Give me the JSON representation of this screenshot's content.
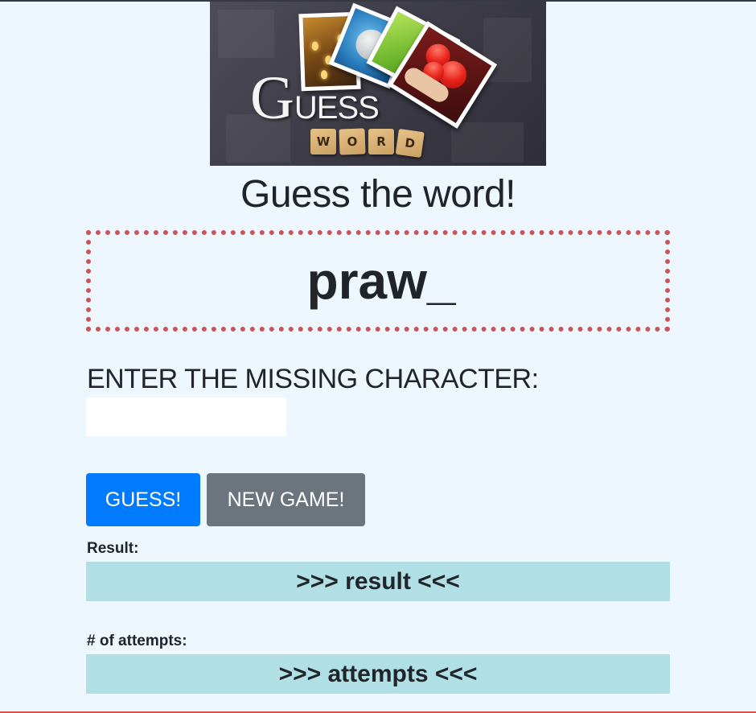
{
  "logo": {
    "big_letter": "G",
    "title_rest": "UESS",
    "tiles": [
      "W",
      "O",
      "R",
      "D"
    ]
  },
  "page": {
    "title": "Guess the word!"
  },
  "puzzle": {
    "word": "praw_"
  },
  "input": {
    "label": "ENTER THE MISSING CHARACTER:",
    "value": "",
    "placeholder": ""
  },
  "buttons": {
    "guess": "GUESS!",
    "new_game": "NEW GAME!"
  },
  "result": {
    "label": "Result:",
    "value": ">>> result <<<"
  },
  "attempts": {
    "label": "# of attempts:",
    "value": ">>> attempts <<<"
  },
  "colors": {
    "background": "#eff7fe",
    "word_border": "#c9555b",
    "guess_button": "#007bff",
    "new_game_button": "#6c757d",
    "info_bar": "#b0e0e6"
  }
}
